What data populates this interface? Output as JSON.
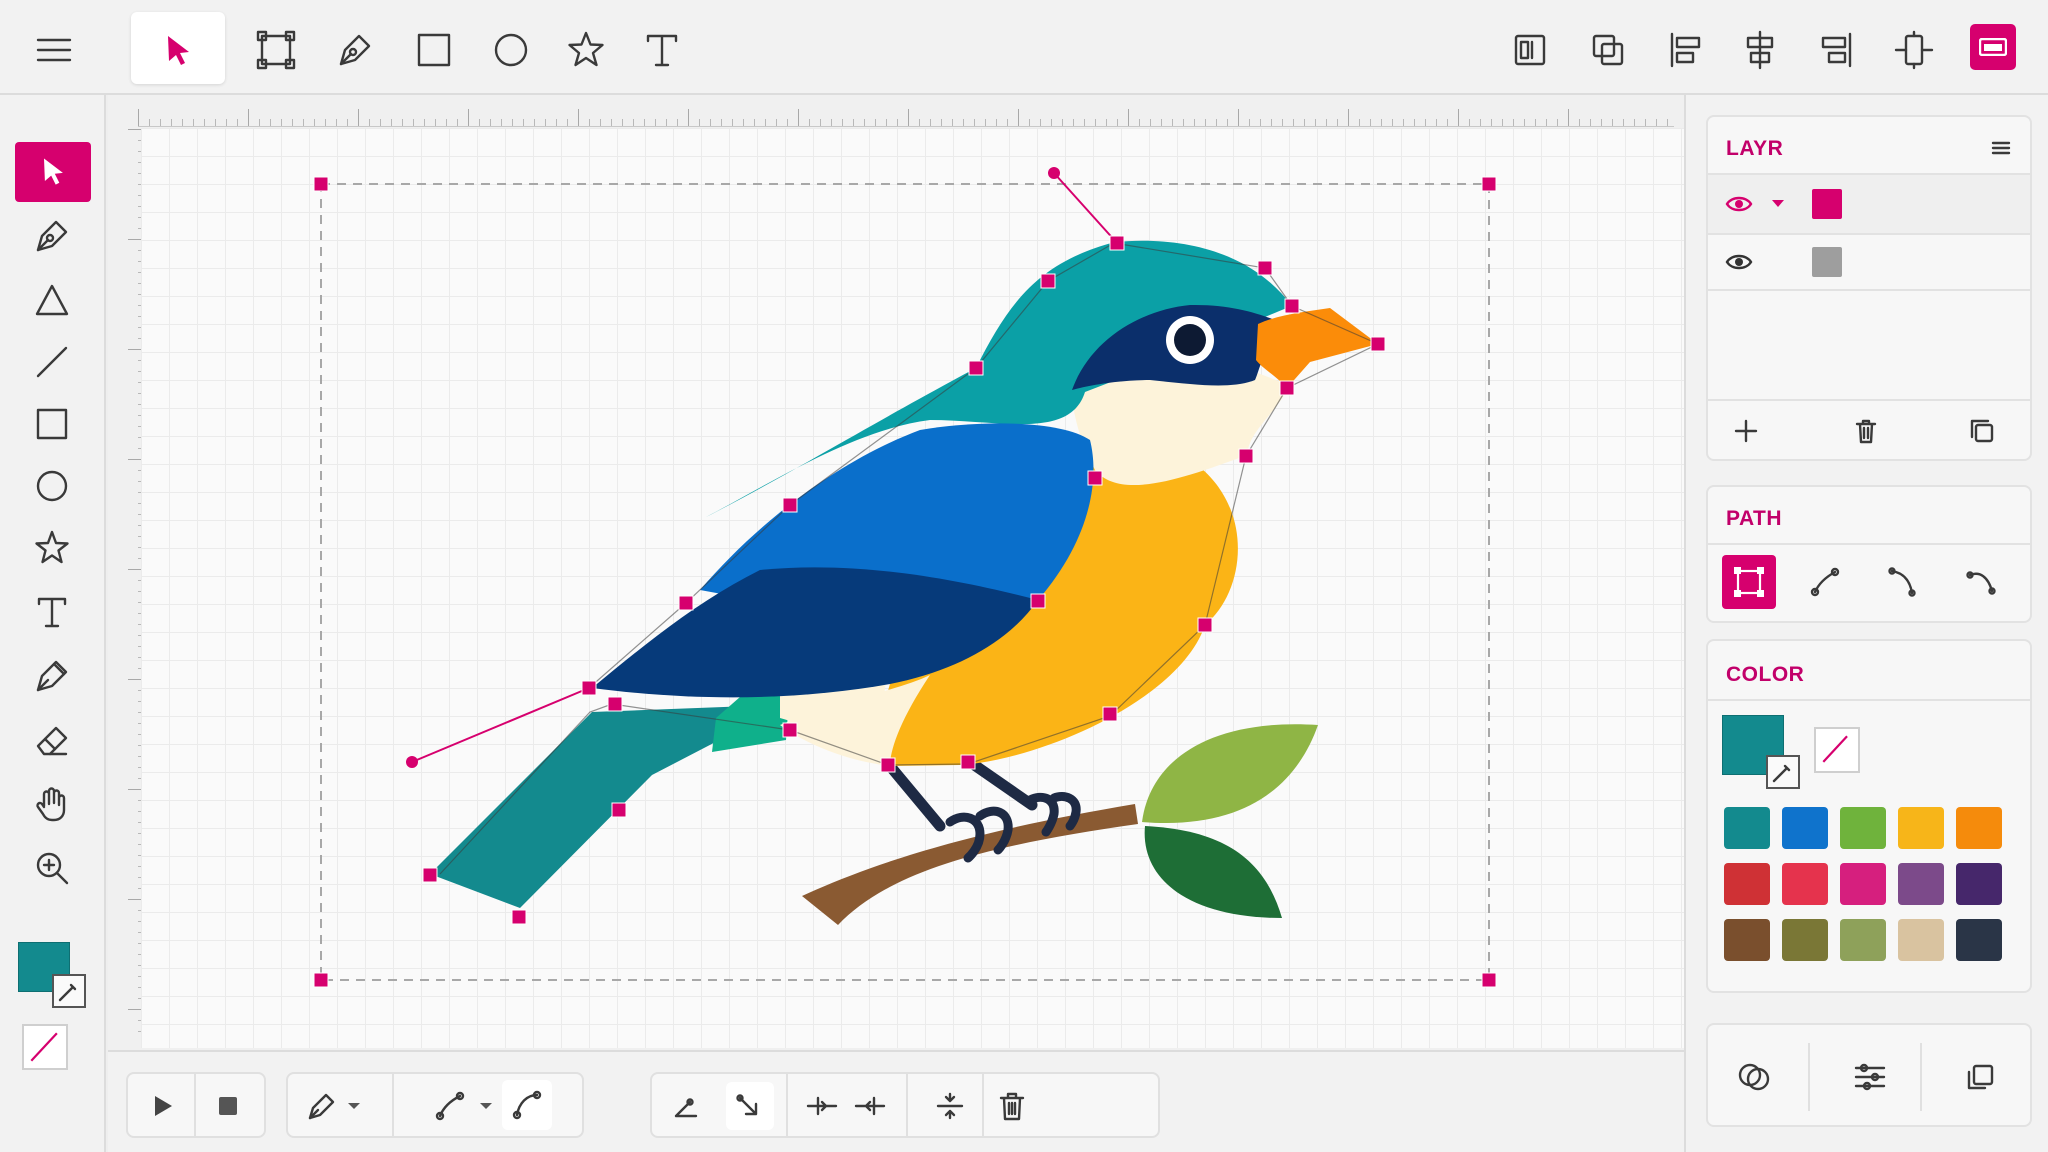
{
  "panels": {
    "layers_title": "LAYR",
    "path_title": "PATH",
    "color_title": "COLOR"
  },
  "colors": {
    "accent": "#d6006e",
    "fill_current": "#138a8e",
    "swatches": [
      "#138a8e",
      "#0f73cc",
      "#6fb33c",
      "#f7b519",
      "#f58b0c",
      "#cf3135",
      "#e5334d",
      "#d61f7e",
      "#7c4a8a",
      "#46276b",
      "#7a4f2d",
      "#7a7736",
      "#8ea15a",
      "#d9c3a0",
      "#2a3547"
    ],
    "layer_swatches": [
      "#d6006e",
      "#9e9e9e"
    ]
  },
  "icons": {
    "top_tools": [
      "menu-icon",
      "select-arrow-icon",
      "transform-icon",
      "pen-icon",
      "rectangle-icon",
      "ellipse-icon",
      "star-icon",
      "text-icon"
    ],
    "top_align": [
      "align-left-edge-icon",
      "align-center-box-icon",
      "align-left-icon",
      "align-center-icon",
      "align-right-icon",
      "distribute-icon",
      "export-icon"
    ],
    "left_tools": [
      "select-arrow-icon",
      "pen-icon",
      "triangle-icon",
      "line-icon",
      "rectangle-icon",
      "ellipse-icon",
      "star-icon",
      "text-icon",
      "pen-nib-icon",
      "eraser-icon",
      "hand-icon",
      "zoom-in-icon"
    ],
    "bottom": [
      "play-icon",
      "stop-icon",
      "pen-icon",
      "chevron-down-icon",
      "node-edit-icon",
      "chevron-down-icon",
      "curve-icon",
      "handle-in-icon",
      "handle-out-icon",
      "split-node-icon",
      "join-node-icon",
      "align-nodes-icon",
      "trash-icon"
    ],
    "right_bottom": [
      "boolean-icon",
      "sliders-icon",
      "copy-icon"
    ]
  }
}
